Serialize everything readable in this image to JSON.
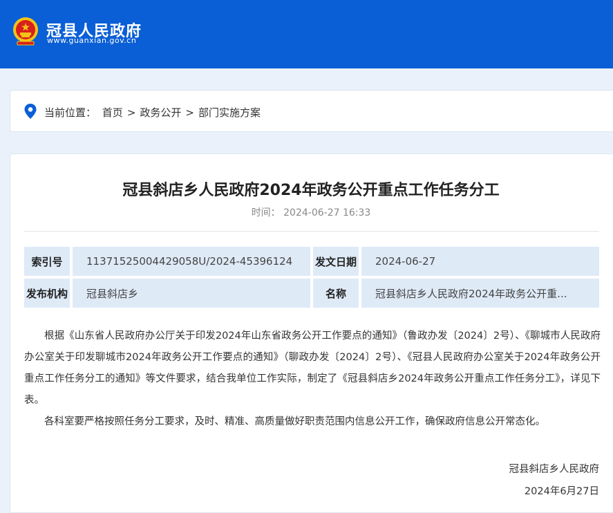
{
  "header": {
    "site_title": "冠县人民政府",
    "site_url": "www.guanxian.gov.cn",
    "colors": {
      "header_bg": "#0a5fd6",
      "page_bg": "#eaf1fb"
    }
  },
  "breadcrumb": {
    "prefix": "当前位置：",
    "items": [
      "首页",
      "政务公开",
      "部门实施方案"
    ],
    "separator": ">"
  },
  "article": {
    "title": "冠县斜店乡人民政府2024年政务公开重点工作任务分工",
    "time_label": "时间：",
    "time_value": "2024-06-27 16:33",
    "meta": {
      "index_label": "索引号",
      "index_value": "11371525004429058U/2024-45396124",
      "date_label": "发文日期",
      "date_value": "2024-06-27",
      "org_label": "发布机构",
      "org_value": "冠县斜店乡",
      "name_label": "名称",
      "name_value": "冠县斜店乡人民政府2024年政务公开重..."
    },
    "paragraphs": [
      "根据《山东省人民政府办公厅关于印发2024年山东省政务公开工作要点的通知》（鲁政办发〔2024〕2号）、《聊城市人民政府办公室关于印发聊城市2024年政务公开工作要点的通知》（聊政办发〔2024〕2号）、《冠县人民政府办公室关于2024年政务公开重点工作任务分工的通知》等文件要求，结合我单位工作实际，制定了《冠县斜店乡2024年政务公开重点工作任务分工》，详见下表。",
      "各科室要严格按照任务分工要求，及时、精准、高质量做好职责范围内信息公开工作，确保政府信息公开常态化。"
    ],
    "sign_org": "冠县斜店乡人民政府",
    "sign_date": "2024年6月27日"
  }
}
